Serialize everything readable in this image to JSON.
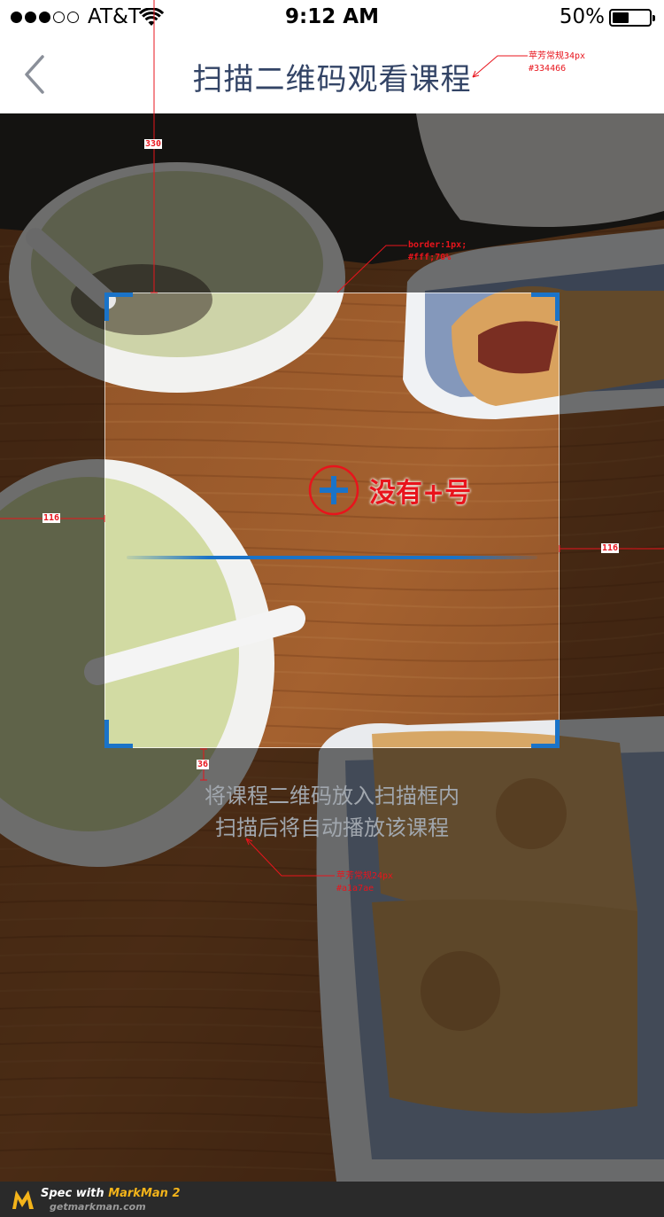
{
  "status_bar": {
    "signal_filled": 3,
    "signal_total": 5,
    "carrier": "AT&T",
    "wifi_icon": "wifi-icon",
    "time": "9:12 AM",
    "battery_percent": "50%",
    "battery_level": 0.5
  },
  "nav": {
    "back_icon": "chevron-left-icon",
    "title": "扫描二维码观看课程",
    "title_color": "#334466"
  },
  "scanner": {
    "frame_border": "rgba(255,255,255,0.7)",
    "accent": "#1a73c8",
    "plus_icon": "plus-circle-icon",
    "plus_note": "没有+号",
    "hint_line1": "将课程二维码放入扫描框内",
    "hint_line2": "扫描后将自动播放该课程",
    "hint_color": "#a1a7ae"
  },
  "annotations": {
    "title_spec_font": "苹芳常规34px",
    "title_spec_color": "#334466",
    "border_spec_1": "border:1px;",
    "border_spec_2": "#fff;70%",
    "dim_top": "330",
    "dim_left": "116",
    "dim_right": "116",
    "dim_gap": "36",
    "hint_spec_font": "苹芳常规24px",
    "hint_spec_color": "#a1a7ae",
    "color": "#e8141c"
  },
  "footer": {
    "logo_icon": "markman-logo-icon",
    "spec_with": "Spec with ",
    "brand": "MarkMan 2",
    "url": "getmarkman.com"
  }
}
